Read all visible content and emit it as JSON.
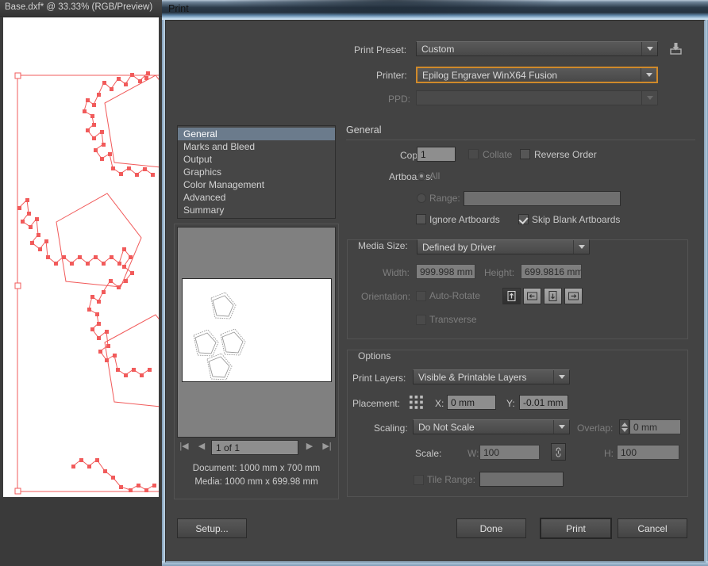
{
  "background_window": {
    "title": "Base.dxf* @ 33.33% (RGB/Preview)"
  },
  "dialog": {
    "title": "Print",
    "preset": {
      "label": "Print Preset:",
      "value": "Custom",
      "save_icon": "save-preset-icon"
    },
    "printer": {
      "label": "Printer:",
      "value": "Epilog Engraver WinX64 Fusion",
      "focus_color": "#d08a2a"
    },
    "ppd": {
      "label": "PPD:",
      "value": ""
    },
    "sidebar": {
      "items": [
        {
          "label": "General",
          "selected": true
        },
        {
          "label": "Marks and Bleed",
          "selected": false
        },
        {
          "label": "Output",
          "selected": false
        },
        {
          "label": "Graphics",
          "selected": false
        },
        {
          "label": "Color Management",
          "selected": false
        },
        {
          "label": "Advanced",
          "selected": false
        },
        {
          "label": "Summary",
          "selected": false
        }
      ],
      "selected_color": "#6b7b8c"
    },
    "preview": {
      "page_nav": {
        "first": "first-page-icon",
        "prev": "previous-page-icon",
        "value": "1 of 1",
        "next": "next-page-icon",
        "last": "last-page-icon"
      },
      "document_info": "Document: 1000 mm x 700 mm",
      "media_info": "Media: 1000 mm x  699.98 mm"
    },
    "general": {
      "heading": "General",
      "copies": {
        "label": "Copies:",
        "value": "1"
      },
      "collate": {
        "label": "Collate",
        "checked": false,
        "enabled": false
      },
      "reverse_order": {
        "label": "Reverse Order",
        "checked": false,
        "enabled": true
      },
      "artboards": {
        "label": "Artboards:"
      },
      "all": {
        "label": "All",
        "selected": true,
        "enabled": false
      },
      "range_radio": {
        "label": "Range:",
        "selected": false,
        "enabled": false
      },
      "range_value": "",
      "ignore_artboards": {
        "label": "Ignore Artboards",
        "checked": false,
        "enabled": true
      },
      "skip_blank_artboards": {
        "label": "Skip Blank Artboards",
        "checked": true,
        "enabled": true
      }
    },
    "media": {
      "group_title": "Media Size:",
      "size_value": "Defined by Driver",
      "width": {
        "label": "Width:",
        "value": "999.998 mm"
      },
      "height": {
        "label": "Height:",
        "value": "699.9816 mm"
      },
      "orientation": {
        "label": "Orientation:"
      },
      "auto_rotate": {
        "label": "Auto-Rotate",
        "checked": false,
        "enabled": false
      },
      "orientation_buttons": [
        {
          "name": "portrait-up-icon",
          "selected": true
        },
        {
          "name": "landscape-left-icon",
          "selected": false
        },
        {
          "name": "portrait-down-icon",
          "selected": false
        },
        {
          "name": "landscape-right-icon",
          "selected": false
        }
      ],
      "transverse": {
        "label": "Transverse",
        "checked": false,
        "enabled": false
      }
    },
    "options": {
      "group_title": "Options",
      "print_layers": {
        "label": "Print Layers:",
        "value": "Visible & Printable Layers"
      },
      "placement": {
        "label": "Placement:",
        "grid_icon": "placement-anchor-grid-icon"
      },
      "x": {
        "label": "X:",
        "value": "0 mm"
      },
      "y": {
        "label": "Y:",
        "value": "-0.01 mm"
      },
      "scaling": {
        "label": "Scaling:",
        "value": "Do Not Scale"
      },
      "overlap": {
        "label": "Overlap:",
        "value": "0 mm",
        "enabled": false
      },
      "scale": {
        "label": "Scale:"
      },
      "scale_w": {
        "label": "W:",
        "value": "100"
      },
      "scale_h": {
        "label": "H:",
        "value": "100"
      },
      "link_icon": "link-chain-icon",
      "tile_range": {
        "label": "Tile Range:",
        "checked": false,
        "enabled": false,
        "value": ""
      }
    },
    "buttons": {
      "setup": "Setup...",
      "done": "Done",
      "print": "Print",
      "cancel": "Cancel"
    }
  }
}
